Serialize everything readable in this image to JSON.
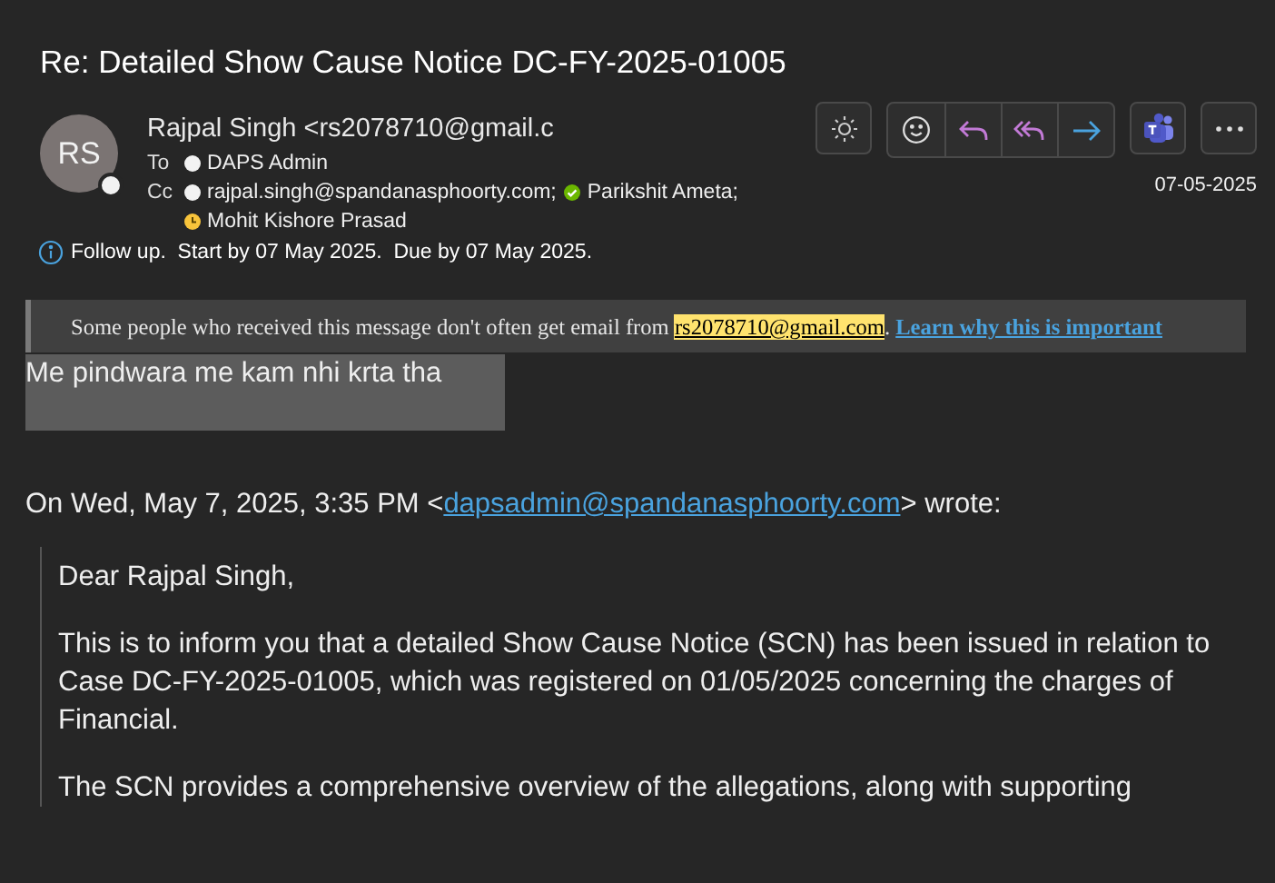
{
  "subject": "Re: Detailed Show Cause Notice DC-FY-2025-01005",
  "sender": {
    "initials": "RS",
    "name": "Rajpal Singh <rs2078710@gmail.c"
  },
  "to": {
    "label": "To",
    "recipients": [
      {
        "name": "DAPS Admin",
        "kind": "unknown"
      }
    ]
  },
  "cc": {
    "label": "Cc",
    "recipients": [
      {
        "name": "rajpal.singh@spandanasphoorty.com;",
        "kind": "unknown"
      },
      {
        "name": "Parikshit Ameta;",
        "kind": "available"
      },
      {
        "name": "Mohit Kishore Prasad",
        "kind": "away"
      }
    ]
  },
  "toolbar": [
    {
      "kind": "theme"
    },
    {
      "kind": "emoji",
      "group": true
    },
    {
      "kind": "reply",
      "group": true
    },
    {
      "kind": "reply-all",
      "group": true
    },
    {
      "kind": "forward",
      "group": true
    },
    {
      "kind": "teams"
    },
    {
      "kind": "more"
    }
  ],
  "date": "07-05-2025",
  "follow_up": "Follow up.  Start by 07 May 2025.  Due by 07 May 2025.",
  "banner": {
    "text": "Some people who received this message don't often get email from ",
    "address": "rs2078710@gmail.com",
    "after": ". ",
    "link": "Learn why this is important"
  },
  "reply_text": "Me pindwara me kam nhi krta tha",
  "quote_header": {
    "before": "On Wed, May 7, 2025, 3:35 PM <",
    "address": "dapsadmin@spandanasphoorty.com",
    "after": "> wrote:"
  },
  "quoted": [
    "Dear Rajpal Singh,",
    "This is to inform you that a detailed Show Cause Notice (SCN) has been issued in relation to Case DC-FY-2025-01005, which was registered on 01/05/2025 concerning the charges of Financial.",
    "The SCN provides a comprehensive overview of the allegations, along with supporting"
  ]
}
